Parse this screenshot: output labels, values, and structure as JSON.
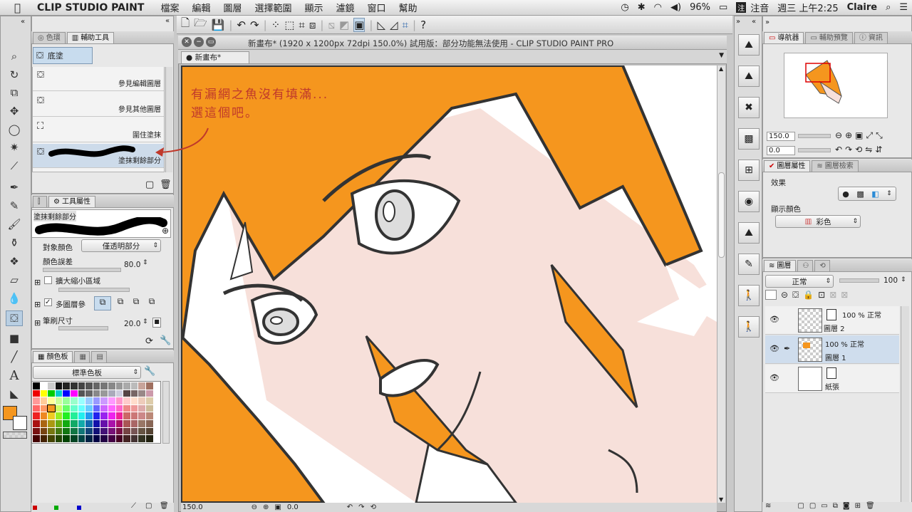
{
  "menubar": {
    "app_name": "CLIP STUDIO PAINT",
    "menus": [
      "檔案",
      "編輯",
      "圖層",
      "選擇範圍",
      "顯示",
      "濾鏡",
      "窗口",
      "幫助"
    ],
    "battery": "96%",
    "input_method": "注音",
    "datetime": "週三 上午2:25",
    "user": "Claire"
  },
  "window": {
    "title": "新畫布* (1920 x 1200px 72dpi 150.0%) 試用版：部分功能無法使用 - CLIP STUDIO PAINT PRO",
    "doc_tab": "新畫布*"
  },
  "left_panel": {
    "tabs": [
      "色環",
      "輔助工具"
    ],
    "active_tool": "底塗",
    "sub_tools": [
      "參見編輯圖層",
      "參見其他圖層",
      "圍住塗抹",
      "塗抹剩餘部分"
    ],
    "tool_property": {
      "tab": "工具屬性",
      "name": "塗抹剩餘部分",
      "target_color_label": "對象顏色",
      "target_color_value": "僅透明部分",
      "tolerance_label": "顏色誤差",
      "tolerance_value": "80.0",
      "expand_label": "擴大縮小區域",
      "multi_ref_label": "多圖層參",
      "brush_size_label": "筆刷尺寸",
      "brush_size_value": "20.0"
    },
    "palette": {
      "tab": "顏色板",
      "set": "標準色板"
    }
  },
  "annotation": {
    "line1": "有漏網之魚沒有填滿...",
    "line2": "選這個吧。"
  },
  "navigator": {
    "tabs": [
      "導航器",
      "輔助預覽",
      "資訊"
    ],
    "zoom": "150.0",
    "rotation": "0.0"
  },
  "layer_property": {
    "tabs": [
      "圖層屬性",
      "圖層檢索"
    ],
    "effect_label": "效果",
    "display_color_label": "顯示顏色",
    "display_color_value": "彩色"
  },
  "layers": {
    "tab": "圖層",
    "blend_mode": "正常",
    "opacity": "100",
    "items": [
      {
        "mode": "100 % 正常",
        "name": "圖層 2"
      },
      {
        "mode": "100 % 正常",
        "name": "圖層 1"
      },
      {
        "mode": "",
        "name": "紙張"
      }
    ]
  },
  "status": {
    "zoom": "150.0",
    "rotation": "0.0"
  },
  "colors": {
    "accent": "#f5961e",
    "annotation": "#c0392b",
    "selection": "#b9cfe3"
  }
}
